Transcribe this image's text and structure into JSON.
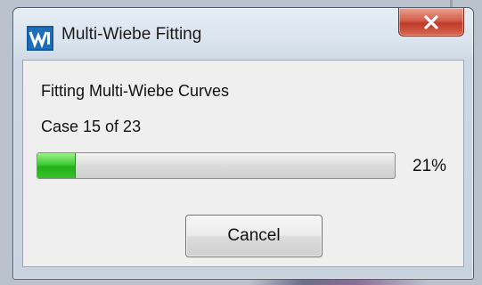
{
  "window": {
    "title": "Multi-Wiebe Fitting",
    "app_icon": "wave-logo-icon",
    "close_icon": "close-x-icon"
  },
  "dialog": {
    "message": "Fitting Multi-Wiebe Curves",
    "case_text": "Case 15 of 23",
    "progress_percent": 21,
    "progress_label": "21%",
    "cancel_label": "Cancel"
  },
  "colors": {
    "progress_fill": "#2fbf24",
    "close_button": "#c0392b",
    "title_bar": "#d9e3ee",
    "client_background": "#efefef"
  }
}
